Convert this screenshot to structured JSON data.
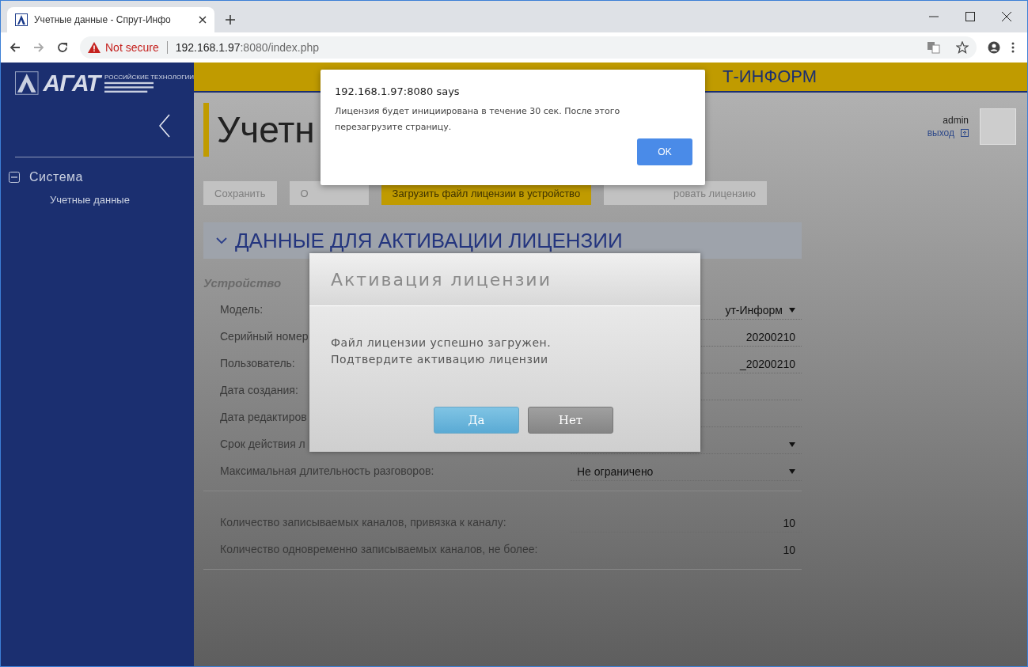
{
  "browser": {
    "tab_title": "Учетные данные - Спрут-Инфо",
    "security": "Not secure",
    "url_host": "192.168.1.97",
    "url_rest": ":8080/index.php"
  },
  "sidebar": {
    "logo": "АГАТ",
    "logo_tagline": "РОССИЙСКИЕ ТЕХНОЛОГИИ",
    "nav": [
      {
        "label": "Система",
        "expanded": true,
        "children": [
          {
            "label": "Учетные данные"
          }
        ]
      }
    ]
  },
  "topbar": {
    "brand": "Т-ИНФОРМ"
  },
  "header": {
    "title": "Учетн",
    "user": "admin",
    "logout": "выход"
  },
  "toolbar": [
    {
      "label": "Сохранить",
      "kind": "plain"
    },
    {
      "label": "О",
      "kind": "plain"
    },
    {
      "label": "Загрузить файл лицензии в устройство",
      "kind": "primary"
    },
    {
      "label": "ровать лицензию",
      "kind": "plain"
    }
  ],
  "section": {
    "title": "ДАННЫЕ ДЛЯ АКТИВАЦИИ ЛИЦЕНЗИИ",
    "expanded": true,
    "subtitle": "Устройство",
    "groups": [
      [
        {
          "label": "Модель:",
          "value": "ут-Информ",
          "kind": "select"
        },
        {
          "label": "Серийный номер",
          "value": "20200210",
          "kind": "text"
        },
        {
          "label": "Пользователь:",
          "value": "_20200210",
          "kind": "text"
        },
        {
          "label": "Дата создания:",
          "kind": "text"
        },
        {
          "label": "Дата редактиров",
          "kind": "text"
        },
        {
          "label": "Срок действия л",
          "kind": "select"
        },
        {
          "label": "Максимальная длительность разговоров:",
          "value": "Не ограничено",
          "kind": "select"
        }
      ],
      [
        {
          "label": "Количество записываемых каналов, привязка к каналу:",
          "value": "10",
          "kind": "text"
        },
        {
          "label": "Количество одновременно записываемых каналов, не более:",
          "value": "10",
          "kind": "text"
        }
      ]
    ]
  },
  "modal": {
    "title": "Активация лицензии",
    "message": [
      "Файл лицензии успешно загружен.",
      "Подтвердите активацию лицензии"
    ],
    "buttons": [
      {
        "label": "Да",
        "kind": "confirm"
      },
      {
        "label": "Нет",
        "kind": "cancel"
      }
    ]
  },
  "alert": {
    "title": "192.168.1.97:8080 says",
    "message": "Лицензия будет инициирована в течение 30 сек. После этого перезагрузите страницу.",
    "button": "OK"
  }
}
